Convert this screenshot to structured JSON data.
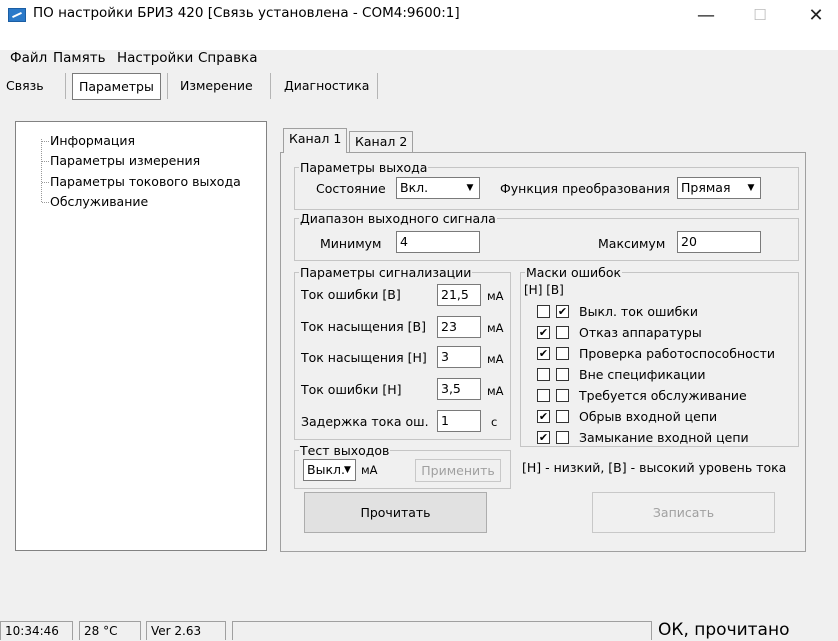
{
  "window": {
    "title": "ПО настройки БРИЗ 420 [Связь установлена - COM4:9600:1]",
    "minimize": "—",
    "maximize": "☐",
    "close": "✕"
  },
  "menu": [
    "Файл",
    "Память",
    "Настройки",
    "Справка"
  ],
  "tabs": [
    "Связь",
    "Параметры",
    "Измерение",
    "Диагностика"
  ],
  "tree": [
    "Информация",
    "Параметры измерения",
    "Параметры токового выхода",
    "Обслуживание"
  ],
  "channel_tabs": [
    "Канал 1",
    "Канал 2"
  ],
  "output": {
    "legend": "Параметры выхода",
    "state_label": "Состояние",
    "state_value": "Вкл.",
    "func_label": "Функция преобразования",
    "func_value": "Прямая"
  },
  "range": {
    "legend": "Диапазон выходного сигнала",
    "min_label": "Минимум",
    "min_value": "4",
    "max_label": "Максимум",
    "max_value": "20"
  },
  "alarm": {
    "legend": "Параметры сигнализации",
    "rows": [
      {
        "label": "Ток ошибки [В]",
        "value": "21,5",
        "unit": "мА"
      },
      {
        "label": "Ток насыщения [В]",
        "value": "23",
        "unit": "мА"
      },
      {
        "label": "Ток насыщения [Н]",
        "value": "3",
        "unit": "мА"
      },
      {
        "label": "Ток ошибки [Н]",
        "value": "3,5",
        "unit": "мА"
      },
      {
        "label": "Задержка тока ош.",
        "value": "1",
        "unit": "с"
      }
    ]
  },
  "masks": {
    "legend": "Маски ошибок",
    "header": "[Н] [В]",
    "rows": [
      {
        "label": "Выкл. ток ошибки",
        "n": false,
        "v": true
      },
      {
        "label": "Отказ аппаратуры",
        "n": true,
        "v": false
      },
      {
        "label": "Проверка работоспособности",
        "n": true,
        "v": false
      },
      {
        "label": "Вне спецификации",
        "n": false,
        "v": false
      },
      {
        "label": "Требуется обслуживание",
        "n": false,
        "v": false
      },
      {
        "label": "Обрыв входной цепи",
        "n": true,
        "v": false
      },
      {
        "label": "Замыкание входной цепи",
        "n": true,
        "v": false
      }
    ],
    "note": "[Н] - низкий, [В] - высокий уровень тока"
  },
  "test": {
    "legend": "Тест выходов",
    "value": "Выкл.",
    "unit": "мА",
    "apply": "Применить"
  },
  "buttons": {
    "read": "Прочитать",
    "write": "Записать"
  },
  "status": {
    "time": "10:34:46",
    "temp": "28 °C",
    "version": "Ver 2.63",
    "message": "ОК, прочитано"
  }
}
